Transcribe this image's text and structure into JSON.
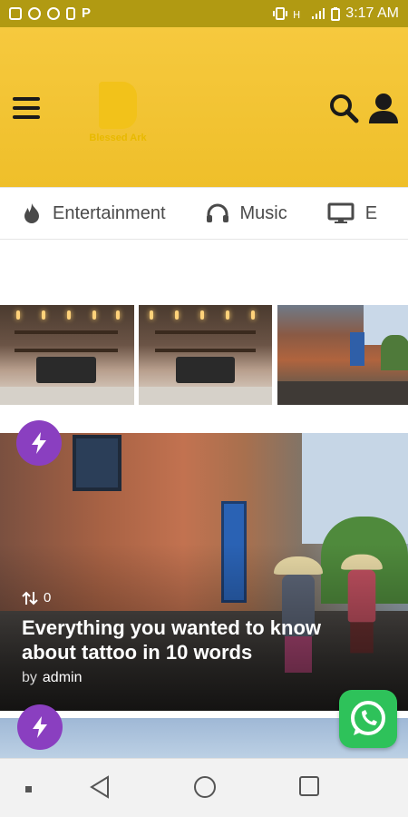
{
  "status_bar": {
    "time": "3:17 AM",
    "left_icons": [
      "gallery-icon",
      "whatsapp-icon",
      "nfc-icon",
      "battery-saver-icon",
      "p-icon"
    ],
    "right_icons": [
      "vibrate-icon",
      "data-icon",
      "signal-icon",
      "battery-icon"
    ]
  },
  "header": {
    "background": "#f2c232",
    "logo_text": "Blessed Ark",
    "menu_icon": "hamburger-icon",
    "search_icon": "search-icon",
    "account_icon": "user-icon"
  },
  "tabs": [
    {
      "label": "Entertainment",
      "icon": "fire-icon"
    },
    {
      "label": "Music",
      "icon": "headphones-icon"
    },
    {
      "label": "E",
      "icon": "monitor-icon"
    }
  ],
  "featured_card": {
    "badge_icon": "lightning-icon",
    "badge_color": "#8a3fc0",
    "count_icon": "sort-icon",
    "count": "0",
    "title": "Everything you wanted to know about tattoo in 10 words",
    "by_label": "by",
    "author": "admin"
  },
  "next_card": {
    "badge_icon": "lightning-icon"
  },
  "floating": {
    "whatsapp_color": "#2ec25a",
    "icon": "whatsapp-icon"
  },
  "nav_bar": {
    "buttons": [
      "square-dot-icon",
      "back-icon",
      "home-icon",
      "recents-icon"
    ]
  }
}
